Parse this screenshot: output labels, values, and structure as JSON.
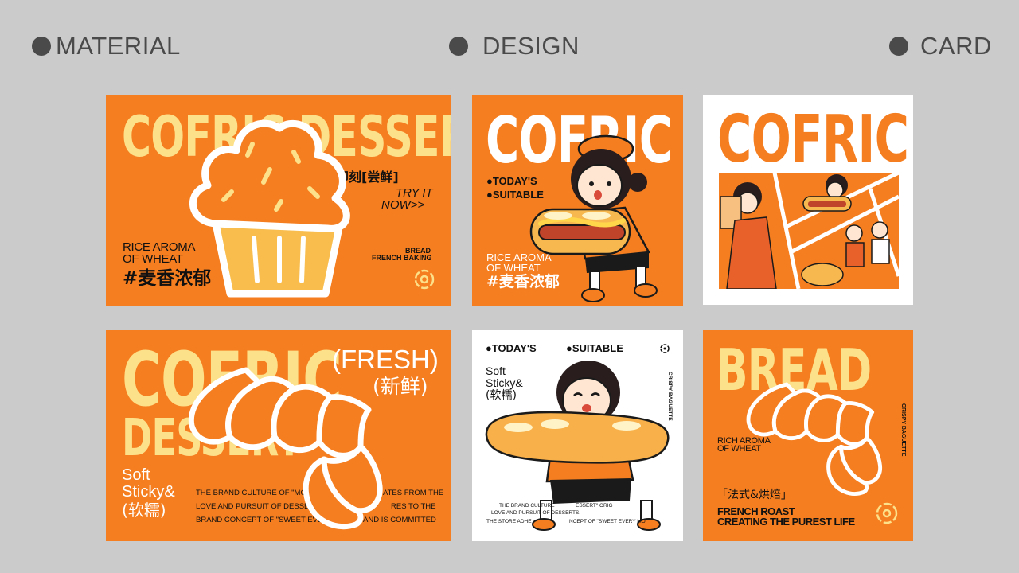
{
  "headers": [
    {
      "label": "MATERIAL"
    },
    {
      "label": "DESIGN"
    },
    {
      "label": "CARD"
    }
  ],
  "card1": {
    "title": "COFRIC DESSERT",
    "cn_tag": "即刻[尝鲜]",
    "try1": "TRY IT",
    "try2": "NOW>>",
    "aroma1": "RICE AROMA",
    "aroma2": "OF WHEAT",
    "cn_big": "#麦香浓郁",
    "bread": "BREAD",
    "baking": "FRENCH BAKING"
  },
  "card2": {
    "title": "COFRIC",
    "line1": "●TODAY'S",
    "line2": "●SUITABLE",
    "aroma1": "RICE AROMA",
    "aroma2": "OF WHEAT",
    "cn_big": "#麦香浓郁"
  },
  "card3": {
    "title": "COFRIC"
  },
  "card4": {
    "title1": "COFRIC",
    "title2": "DESSERT",
    "fresh": "(FRESH)",
    "fresh_cn": "(新鲜)",
    "soft1": "Soft",
    "soft2": "Sticky&",
    "soft3": "(软糯)",
    "body1": "THE BRAND CULTURE OF \"MONE",
    "body1b": "ATES FROM THE",
    "body2": "LOVE AND PURSUIT OF DESSERTS. T",
    "body2b": "RES TO THE",
    "body3": "BRAND CONCEPT OF \"SWEET EVERY",
    "body3b": "AND IS COMMITTED"
  },
  "card5": {
    "today": "●TODAY'S",
    "suitable": "●SUITABLE",
    "soft1": "Soft",
    "soft2": "Sticky&",
    "soft3": "(软糯)",
    "side": "CRISPY BAGUETTE",
    "small1": "THE BRAND CULTURE",
    "small1b": "ESSERT\" ORIG",
    "small2": "LOVE AND PURSUIT OF DESSERTS.",
    "small3": "THE STORE ADHE",
    "small3b": "NCEPT OF \"SWEET EVERY MO"
  },
  "card6": {
    "title": "BREAD",
    "aroma1": "RICH AROMA",
    "aroma2": "OF WHEAT",
    "side": "CRISPY BAGUETTE",
    "cn": "「法式&烘焙」",
    "roast": "FRENCH ROAST",
    "purest": "CREATING THE PUREST LIFE"
  },
  "colors": {
    "background": "#cbcbcb",
    "orange": "#f57e20",
    "cream": "#fde08a",
    "header_text": "#4a4a4a"
  }
}
